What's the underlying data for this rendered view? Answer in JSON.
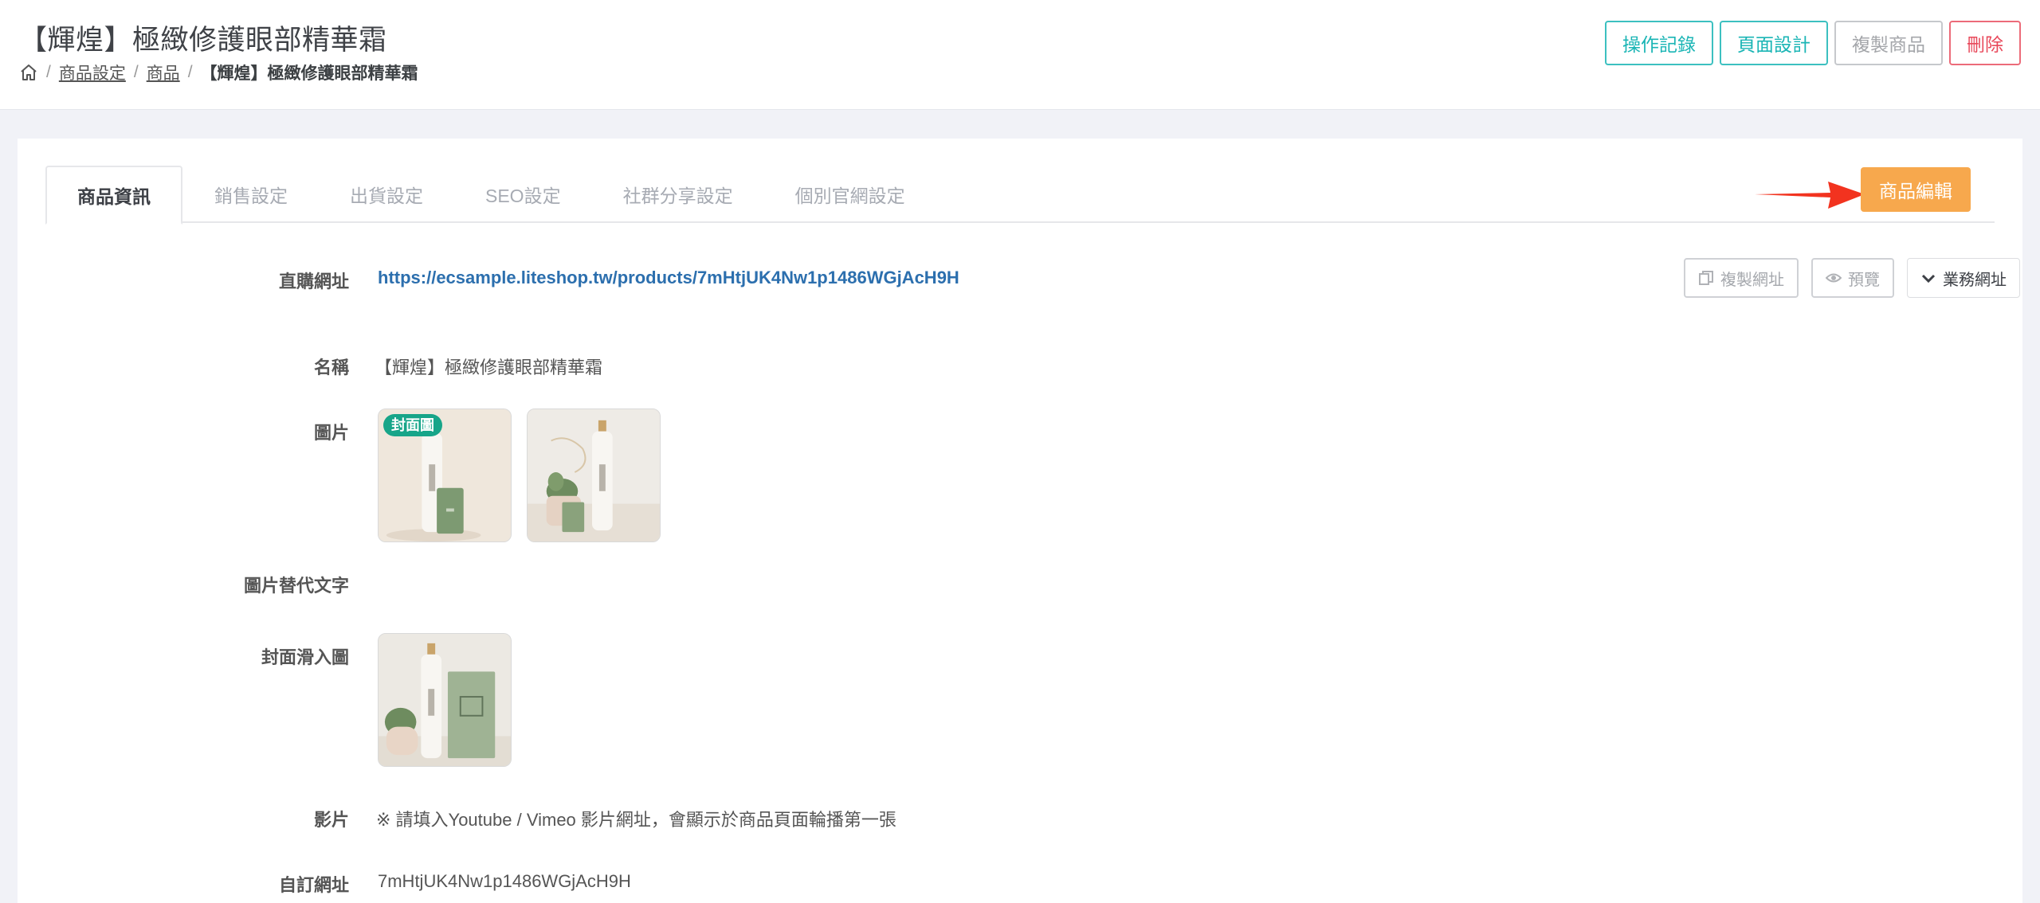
{
  "header": {
    "title": "【輝煌】極緻修護眼部精華霜",
    "breadcrumb": {
      "items": [
        "商品設定",
        "商品"
      ],
      "current": "【輝煌】極緻修護眼部精華霜"
    },
    "actions": {
      "log": "操作記錄",
      "page_design": "頁面設計",
      "copy_product": "複製商品",
      "delete": "刪除"
    }
  },
  "tabs": [
    "商品資訊",
    "銷售設定",
    "出貨設定",
    "SEO設定",
    "社群分享設定",
    "個別官網設定"
  ],
  "edit_button": "商品編輯",
  "form": {
    "url_label": "直購網址",
    "url_value": "https://ecsample.liteshop.tw/products/7mHtjUK4Nw1p1486WGjAcH9H",
    "url_actions": {
      "copy": "複製網址",
      "preview": "預覽",
      "business": "業務網址"
    },
    "name_label": "名稱",
    "name_value": "【輝煌】極緻修護眼部精華霜",
    "images_label": "圖片",
    "cover_badge": "封面圖",
    "alt_text_label": "圖片替代文字",
    "cover_slide_label": "封面滑入圖",
    "video_label": "影片",
    "video_hint": "※ 請填入Youtube / Vimeo 影片網址，會顯示於商品頁面輪播第一張",
    "custom_url_label": "自訂網址",
    "custom_url_value": "7mHtjUK4Nw1p1486WGjAcH9H"
  },
  "colors": {
    "teal": "#1ab5b5",
    "grey": "#a4a6aa",
    "red": "#e8485a",
    "orange": "#f7a84d",
    "link": "#2c6fae",
    "badge": "#17a589"
  }
}
